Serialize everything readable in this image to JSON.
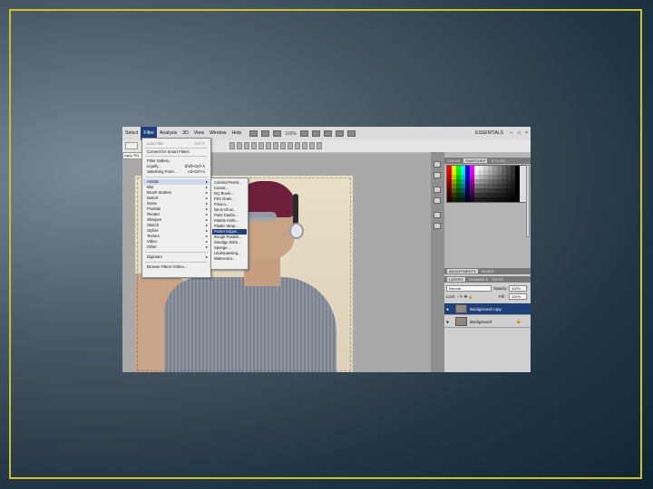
{
  "menubar": {
    "items": [
      "Select",
      "Filter",
      "Analysis",
      "3D",
      "View",
      "Window",
      "Help"
    ],
    "active_index": 1,
    "zoom": "100%",
    "workspace": "ESSENTIALS",
    "window_controls": [
      "–",
      "□",
      "×"
    ]
  },
  "document": {
    "tab_label": "copy, RG"
  },
  "filter_menu": {
    "items": [
      {
        "label": "Last Filter",
        "shortcut": "Ctrl+F",
        "disabled": true
      },
      {
        "label": "Convert for Smart Filters"
      },
      {
        "label": "Filter Gallery..."
      },
      {
        "label": "Liquify...",
        "shortcut": "Shift+Ctrl+X"
      },
      {
        "label": "Vanishing Point...",
        "shortcut": "Alt+Ctrl+V"
      },
      {
        "label": "Artistic",
        "submenu": true
      },
      {
        "label": "Blur",
        "submenu": true
      },
      {
        "label": "Brush Strokes",
        "submenu": true
      },
      {
        "label": "Distort",
        "submenu": true
      },
      {
        "label": "Noise",
        "submenu": true
      },
      {
        "label": "Pixelate",
        "submenu": true
      },
      {
        "label": "Render",
        "submenu": true
      },
      {
        "label": "Sharpen",
        "submenu": true
      },
      {
        "label": "Sketch",
        "submenu": true
      },
      {
        "label": "Stylize",
        "submenu": true
      },
      {
        "label": "Texture",
        "submenu": true
      },
      {
        "label": "Video",
        "submenu": true
      },
      {
        "label": "Other",
        "submenu": true
      },
      {
        "label": "Digimarc",
        "submenu": true
      },
      {
        "label": "Browse Filters Online..."
      }
    ]
  },
  "artistic_submenu": {
    "items": [
      "Colored Pencil...",
      "Cutout...",
      "Dry Brush...",
      "Film Grain...",
      "Fresco...",
      "Neon Glow...",
      "Paint Daubs...",
      "Palette Knife...",
      "Plastic Wrap...",
      "Poster Edges...",
      "Rough Pastels...",
      "Smudge Stick...",
      "Sponge...",
      "Underpainting...",
      "Watercolor..."
    ],
    "highlighted_index": 9
  },
  "panels": {
    "color_tabs": [
      "COLOR",
      "SWATCHES",
      "STYLES"
    ],
    "adjust_tabs": [
      "ADJUSTMENTS",
      "MASKS"
    ],
    "layer_tabs": [
      "LAYERS",
      "CHANNELS",
      "PATHS"
    ]
  },
  "layers": {
    "blend_mode": "Normal",
    "opacity_label": "Opacity:",
    "opacity": "100%",
    "lock_label": "Lock:",
    "fill_label": "Fill:",
    "fill": "100%",
    "rows": [
      {
        "name": "Background copy",
        "selected": true
      },
      {
        "name": "Background",
        "selected": false
      }
    ]
  },
  "swatch_colors": [
    "#ff0000",
    "#ffff00",
    "#00ff00",
    "#00ffff",
    "#0000ff",
    "#ff00ff",
    "#ffffff",
    "#e6e6e6",
    "#cccccc",
    "#b3b3b3",
    "#999999",
    "#808080",
    "#666666",
    "#4d4d4d",
    "#333333",
    "#000000"
  ],
  "icons": {
    "eye": "eye-icon",
    "lock": "lock-icon"
  }
}
